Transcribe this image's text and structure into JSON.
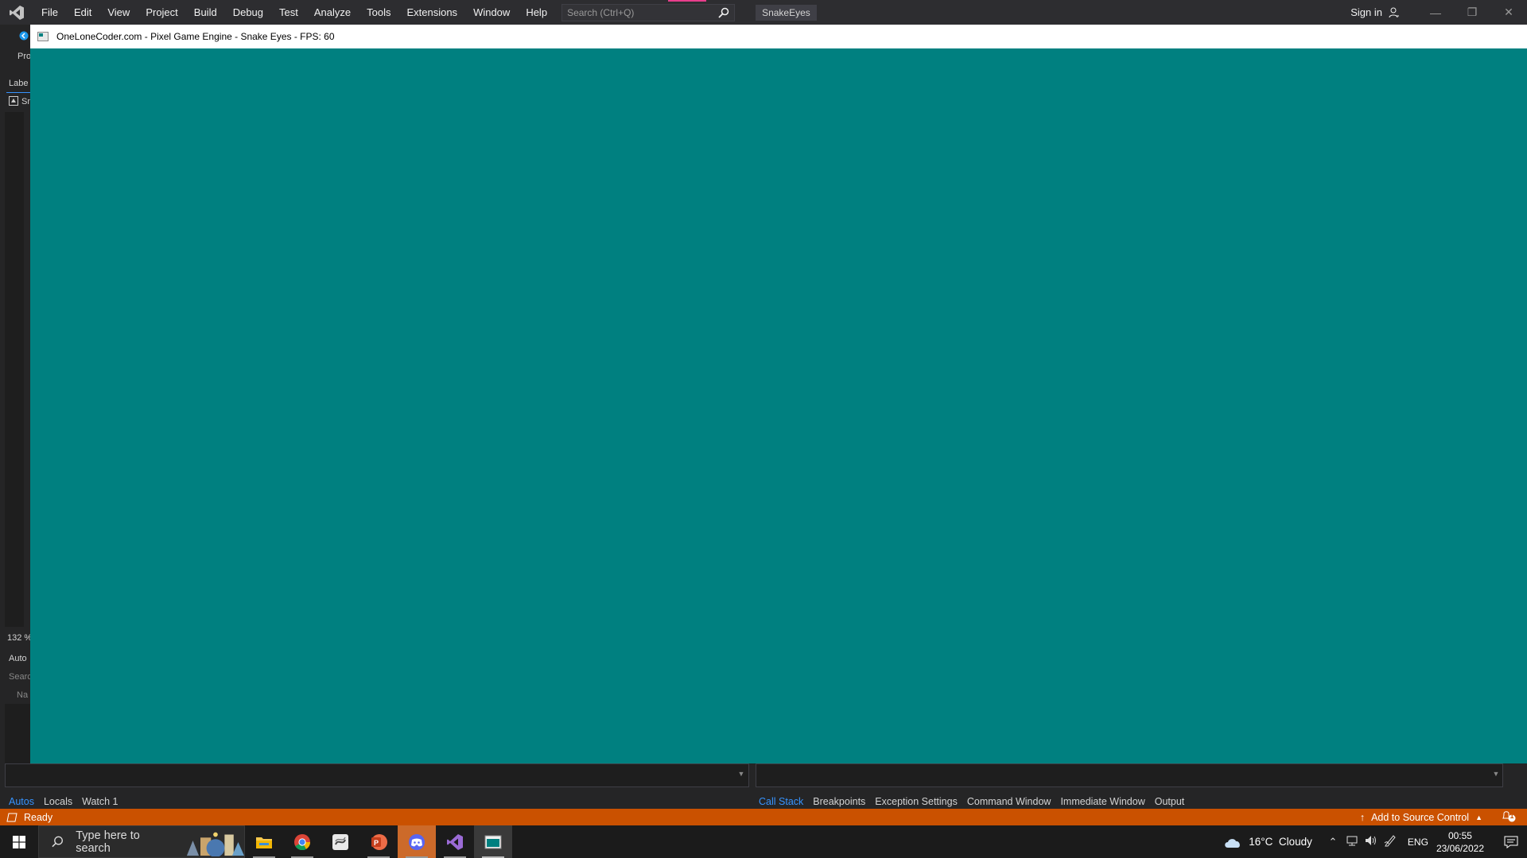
{
  "menubar": {
    "items": [
      "File",
      "Edit",
      "View",
      "Project",
      "Build",
      "Debug",
      "Test",
      "Analyze",
      "Tools",
      "Extensions",
      "Window",
      "Help"
    ],
    "search_placeholder": "Search (Ctrl+Q)",
    "solution_name": "SnakeEyes",
    "sign_in": "Sign in"
  },
  "left_panel": {
    "properties_fragment": "Pro",
    "label_tab_fragment": "Labe",
    "item_fragment": "Sn",
    "zoom": "132 %",
    "autos_fragment": "Auto",
    "search_fragment": "Searc",
    "name_fragment": "Na"
  },
  "game_window": {
    "title": "OneLoneCoder.com - Pixel Game Engine - Snake Eyes - FPS: 60",
    "background_color": "#008080"
  },
  "bottom_tabs": {
    "left": [
      "Autos",
      "Locals",
      "Watch 1"
    ],
    "left_active": "Autos",
    "right": [
      "Call Stack",
      "Breakpoints",
      "Exception Settings",
      "Command Window",
      "Immediate Window",
      "Output"
    ],
    "right_active": "Call Stack"
  },
  "statusbar": {
    "status": "Ready",
    "source_control": "Add to Source Control",
    "notification_count": "1",
    "color": "#ca5100"
  },
  "taskbar": {
    "search_placeholder": "Type here to search",
    "apps": [
      "search-highlight-illustration",
      "file-explorer-icon",
      "chrome-icon",
      "app-icon",
      "powerpoint-icon",
      "discord-icon",
      "visual-studio-icon",
      "game-window-icon"
    ],
    "weather": "16°C  Cloudy",
    "language": "ENG",
    "time": "00:55",
    "date": "23/06/2022"
  }
}
